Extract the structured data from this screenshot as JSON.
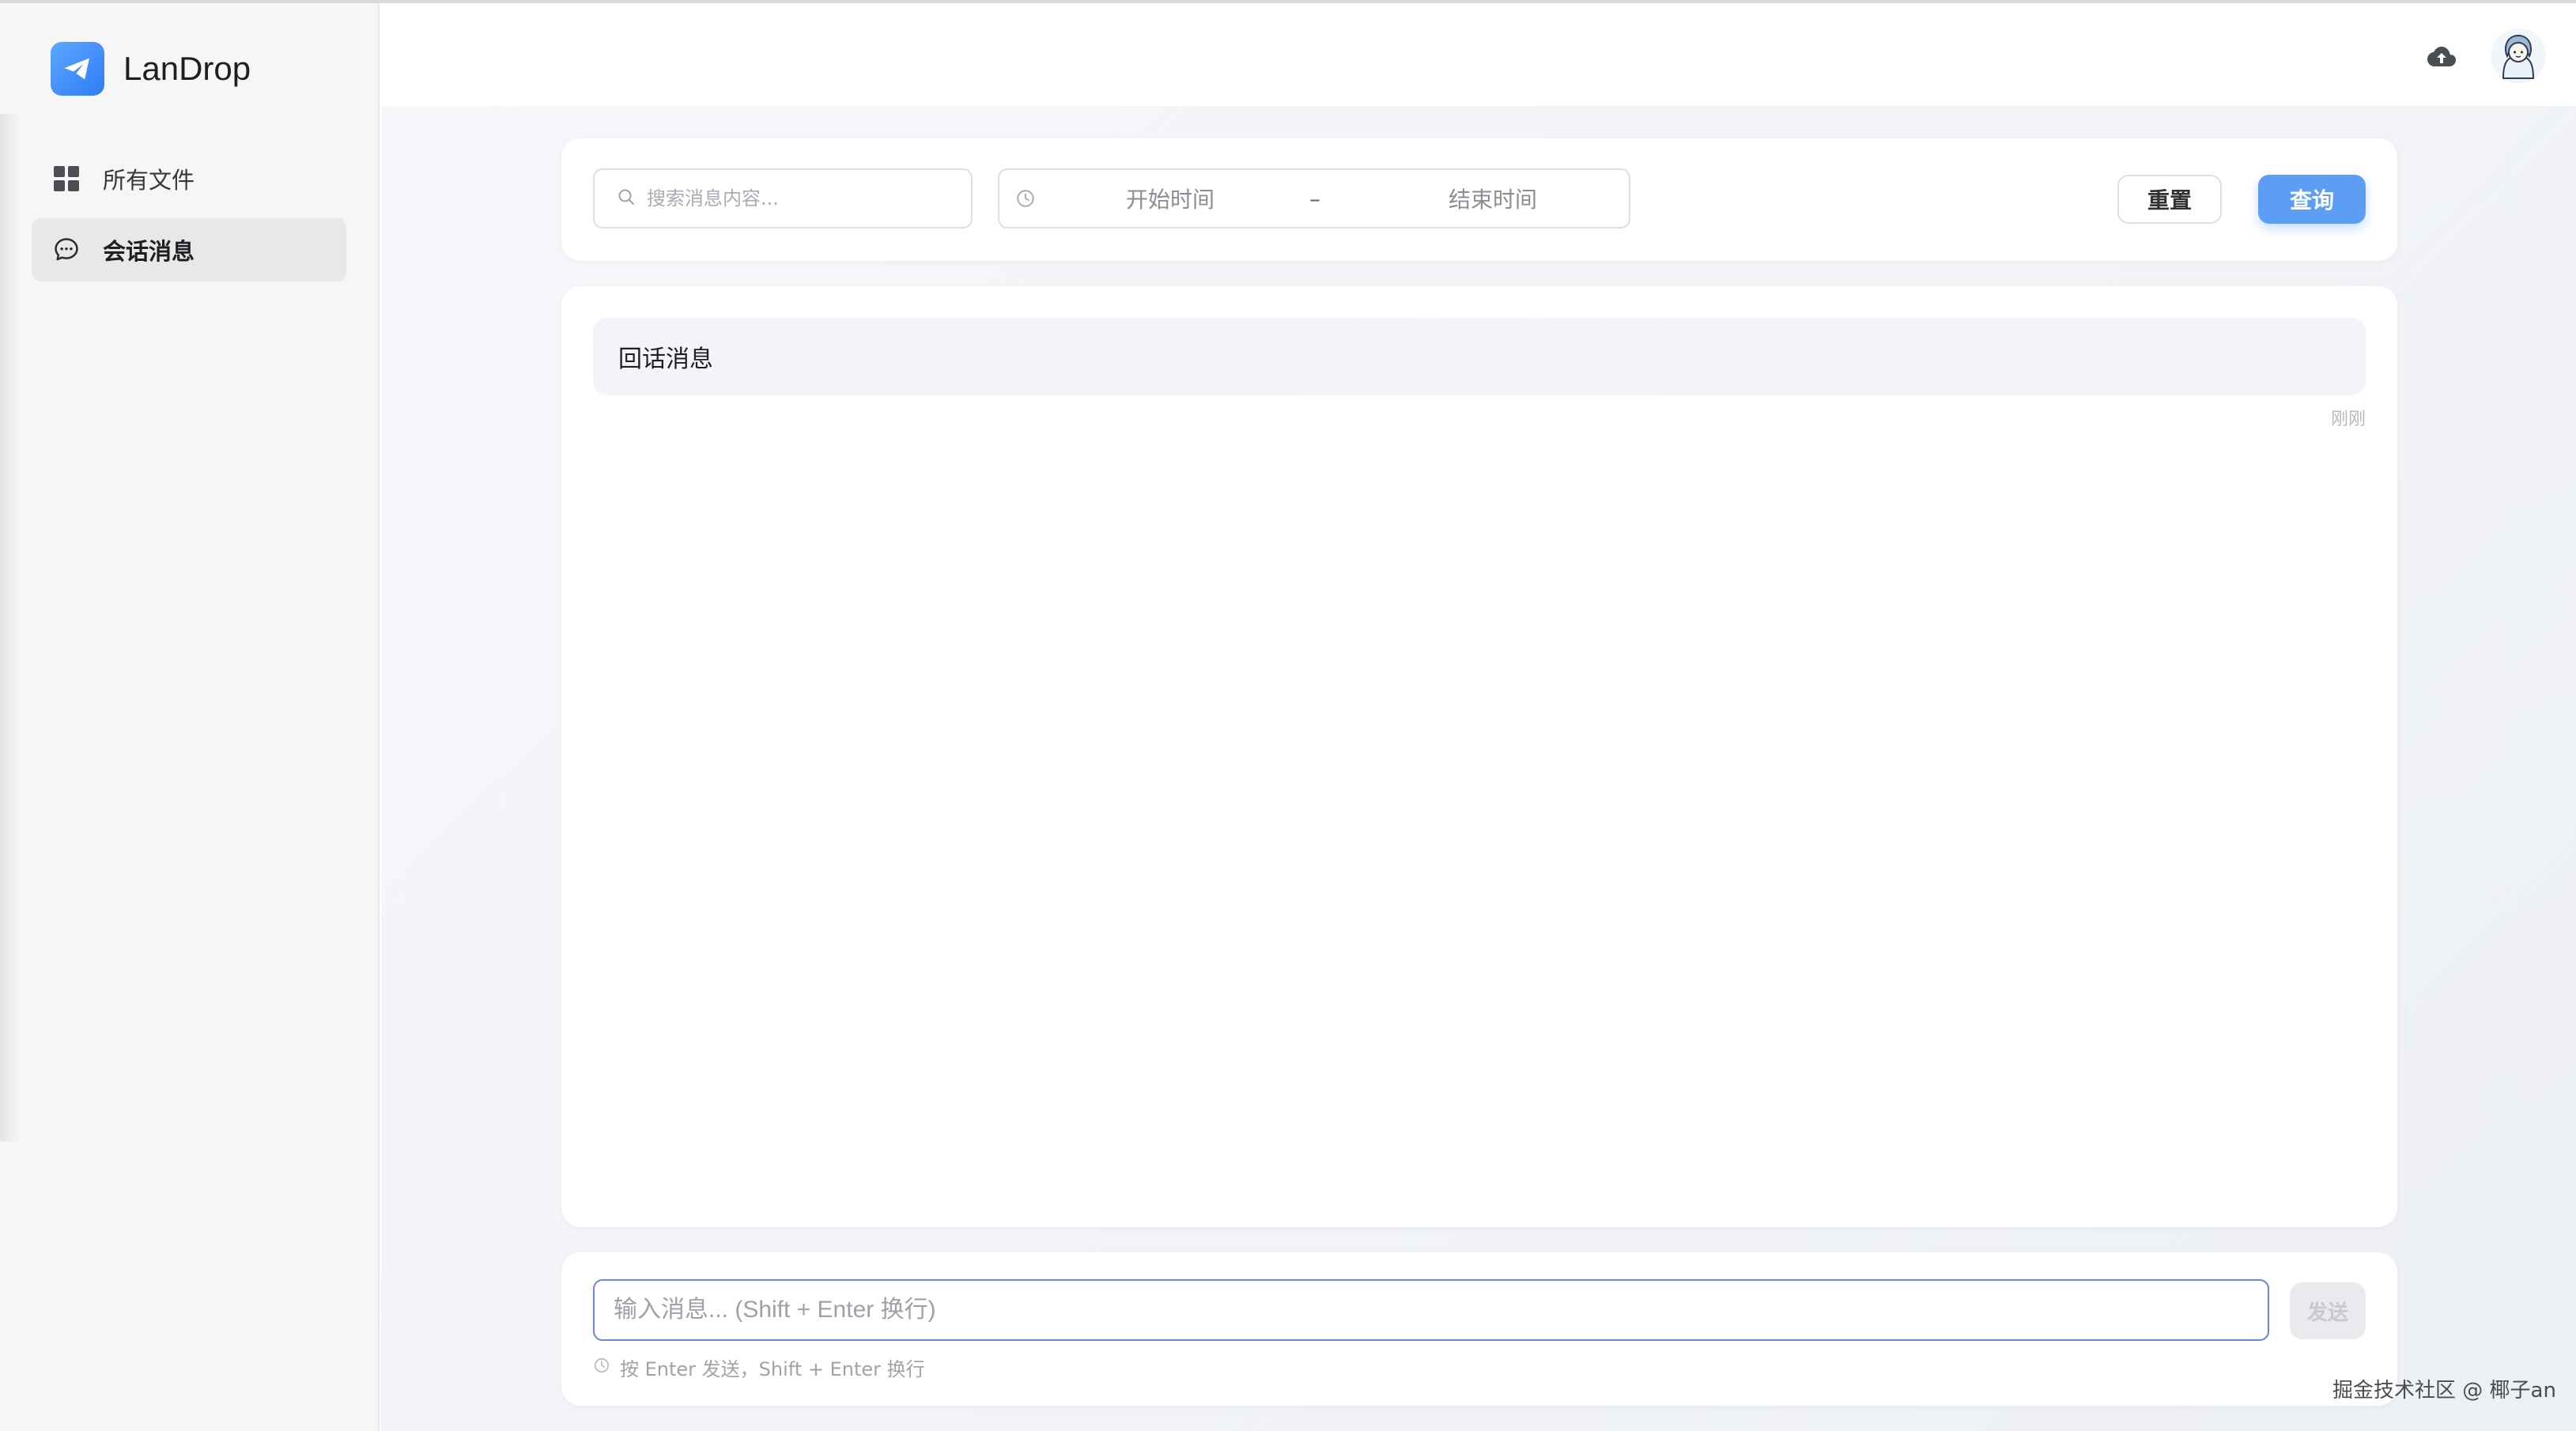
{
  "app": {
    "name": "LanDrop",
    "accent": "#5b9ef4"
  },
  "sidebar": {
    "items": [
      {
        "label": "所有文件",
        "icon": "grid-icon",
        "active": false
      },
      {
        "label": "会话消息",
        "icon": "chat-bubble-icon",
        "active": true
      }
    ]
  },
  "header": {
    "upload_icon": "cloud-upload-icon",
    "avatar_icon": "user-avatar-icon"
  },
  "filter": {
    "search_placeholder": "搜索消息内容...",
    "start_placeholder": "开始时间",
    "separator": "–",
    "end_placeholder": "结束时间",
    "reset_label": "重置",
    "query_label": "查询"
  },
  "messages": [
    {
      "text": "回话消息",
      "time": "刚刚"
    }
  ],
  "composer": {
    "placeholder": "输入消息... (Shift + Enter 换行)",
    "send_label": "发送",
    "hint": "按 Enter 发送，Shift + Enter 换行"
  },
  "watermark": "掘金技术社区 @ 椰子an"
}
